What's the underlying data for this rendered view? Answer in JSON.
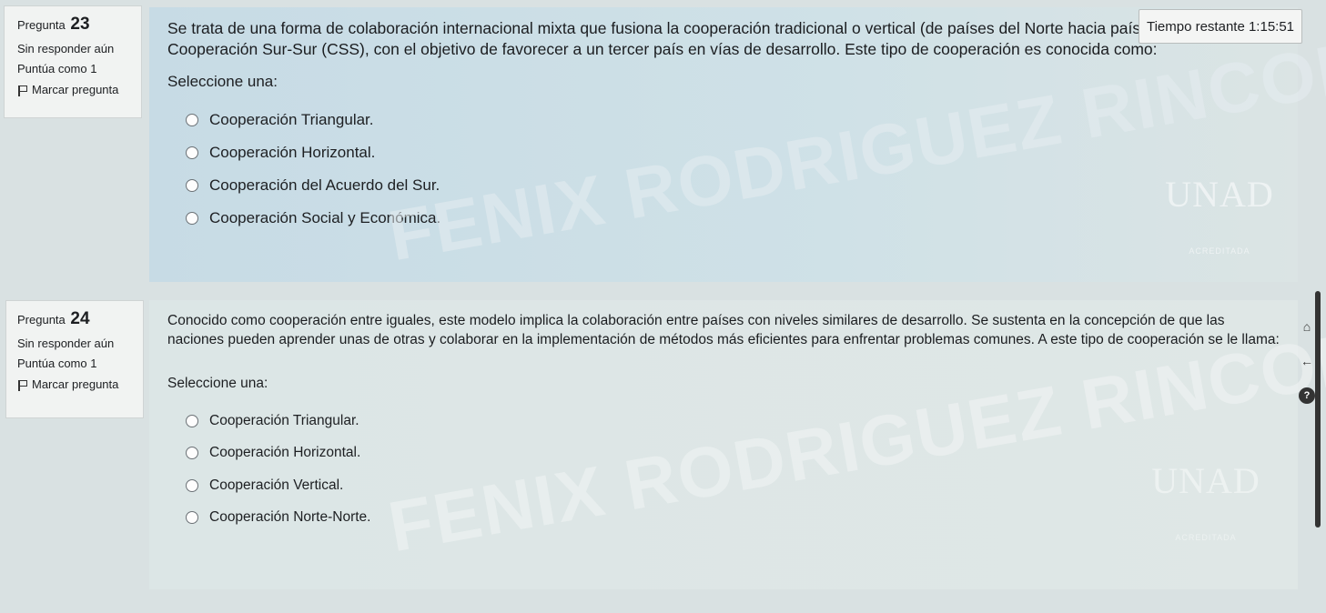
{
  "timer": {
    "label": "Tiempo restante 1:15:51"
  },
  "questions": [
    {
      "label": "Pregunta",
      "number": "23",
      "status": "Sin responder aún",
      "points": "Puntúa como 1",
      "flag_label": "Marcar pregunta",
      "text": "Se trata de una forma de colaboración internacional mixta que fusiona la cooperación tradicional o vertical (de países del Norte hacia países del Sur) con la Cooperación Sur-Sur (CSS), con el objetivo de favorecer a un tercer país en vías de desarrollo. Este tipo de cooperación es conocida como:",
      "prompt": "Seleccione una:",
      "options": [
        "Cooperación Triangular.",
        "Cooperación Horizontal.",
        "Cooperación del Acuerdo del Sur.",
        "Cooperación Social y Económica."
      ]
    },
    {
      "label": "Pregunta",
      "number": "24",
      "status": "Sin responder aún",
      "points": "Puntúa como 1",
      "flag_label": "Marcar pregunta",
      "text": "Conocido como cooperación entre iguales, este modelo implica la colaboración entre países con niveles similares de desarrollo. Se sustenta en la concepción de que las naciones pueden aprender unas de otras y colaborar en la implementación de métodos más eficientes para enfrentar problemas comunes. A este tipo de cooperación se le llama:",
      "prompt": "Seleccione una:",
      "options": [
        "Cooperación Triangular.",
        "Cooperación Horizontal.",
        "Cooperación Vertical.",
        "Cooperación Norte-Norte."
      ]
    }
  ],
  "watermark": {
    "text": "FENIX RODRIGUEZ RINCON"
  },
  "logo": {
    "mark": "UNAD",
    "sub": "ACREDITADA"
  },
  "colors": {
    "content_bg": "#cddfe6",
    "info_bg": "#f1f3f2"
  }
}
